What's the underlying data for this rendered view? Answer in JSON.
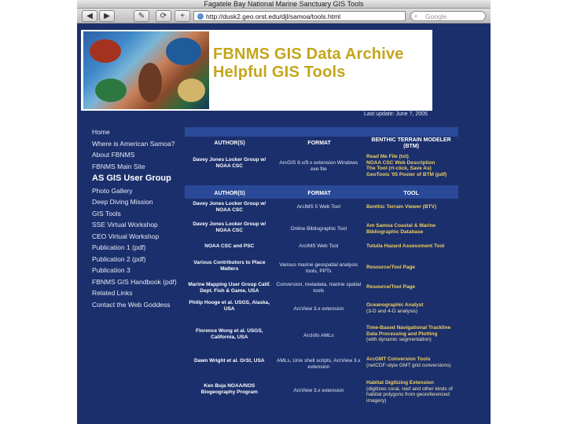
{
  "window": {
    "title": "Fagatele Bay National Marine Sanctuary GIS Tools",
    "url": "http://dusk2.geo.orst.edu/djl/samoa/tools.html",
    "search_placeholder": "Google",
    "buttons": {
      "back": "◀",
      "forward": "▶",
      "bookmarks": "✎",
      "reload": "⟳",
      "new_tab": "+"
    }
  },
  "banner": {
    "line1": "FBNMS GIS Data Archive",
    "line2": "Helpful GIS Tools"
  },
  "last_update": "Last update: June 7, 2005",
  "sidebar": {
    "items": [
      "Home",
      "Where is American Samoa?",
      "About FBNMS",
      "FBNMS Main Site",
      "AS GIS User Group",
      "Photo Gallery",
      "Deep Diving Mission",
      "GIS Tools",
      "SSE Virtual Workshop",
      "CEO Virtual Workshop",
      "Publication 1 (pdf)",
      "Publication 2 (pdf)",
      "Publication 3",
      "FBNMS GIS Handbook (pdf)",
      "Related Links",
      "Contact the Web Goddess"
    ]
  },
  "table": {
    "headers1": [
      "AUTHOR(S)",
      "FORMAT",
      "BENTHIC TERRAIN MODELER (BTM)"
    ],
    "btm_row": {
      "author": "Davey Jones Locker Group w/ NOAA CSC",
      "format": "ArcGIS 8.x/9.x extension Windows exe file",
      "tool_lines": [
        "Read Me File (txt)",
        "NOAA CSC Web Description",
        "The Tool (rt-click, Save As)",
        "GeoTools '05 Poster of BTM (pdf)"
      ]
    },
    "headers2": [
      "AUTHOR(S)",
      "FORMAT",
      "TOOL"
    ],
    "rows": [
      {
        "author": "Davey Jones Locker Group w/ NOAA CSC",
        "format": "ArcIMS 5 Web Tool",
        "tool": "Benthic Terrain Viewer (BTV)",
        "sub": ""
      },
      {
        "author": "Davey Jones Locker Group w/ NOAA CSC",
        "format": "Online Bibliographic Tool",
        "tool": "Am Samoa Coastal & Marine Bibliographic Database",
        "sub": ""
      },
      {
        "author": "NOAA CSC and PSC",
        "format": "ArcIMS Web Tool",
        "tool": "Tutuila Hazard Assessment Tool",
        "sub": ""
      },
      {
        "author": "Various Contributors to Place Matters",
        "format": "Various marine geospatial analysis tools, PPTs",
        "tool": "Resource/Tool Page",
        "sub": ""
      },
      {
        "author": "Marine Mapping User Group Calif. Dept. Fish & Game, USA",
        "format": "Conversion, metadata, marine spatial tools",
        "tool": "Resource/Tool Page",
        "sub": ""
      },
      {
        "author": "Philip Hooge et al. USGS, Alaska, USA",
        "format": "ArcView 3.x extension",
        "tool": "Oceanographic Analyst",
        "sub": "(3-D and 4-D analysis)"
      },
      {
        "author": "Florence Wong et al. USGS, California, USA",
        "format": "ArcInfo AMLs",
        "tool": "Time-Based Navigational Trackline Data Processing and Plotting",
        "sub": "(with dynamic segmentation)"
      },
      {
        "author": "Dawn Wright et al. OrSt, USA",
        "format": "AMLs, Unix shell scripts, ArcView 3.x extension",
        "tool": "ArcGMT Conversion Tools",
        "sub": "(netCDF-style GMT grid conversions)"
      },
      {
        "author": "Ken Buja NOAA/NOS Biogeography Program",
        "format": "ArcView 3.x extension",
        "tool": "Habitat Digitizing Extension",
        "sub": "(digitizes coral, reef and other kinds of habitat polygons from georeferenced imagery)"
      }
    ]
  }
}
